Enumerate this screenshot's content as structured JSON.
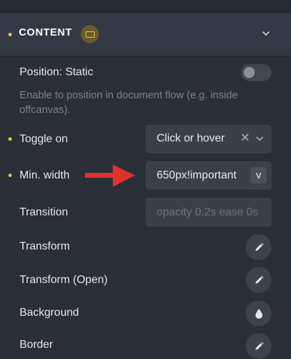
{
  "section": {
    "title": "CONTENT",
    "badge_icon": "monitor-icon",
    "collapse_icon": "chevron-down-icon",
    "accent_color": "#e8c547"
  },
  "position": {
    "label": "Position: Static",
    "enabled": false,
    "description": "Enable to position in document flow (e.g. inside offcanvas)."
  },
  "toggle_on": {
    "label": "Toggle on",
    "value": "Click or hover",
    "clear_icon": "close-icon",
    "dropdown_icon": "chevron-down-icon"
  },
  "min_width": {
    "label": "Min. width",
    "value": "650px!important",
    "unit": "v"
  },
  "transition": {
    "label": "Transition",
    "placeholder": "opacity 0.2s ease 0s"
  },
  "transform": {
    "label": "Transform",
    "icon": "pencil-icon"
  },
  "transform_open": {
    "label": "Transform (Open)",
    "icon": "pencil-icon"
  },
  "background": {
    "label": "Background",
    "icon": "droplet-icon"
  },
  "border": {
    "label": "Border",
    "icon": "pencil-icon"
  },
  "annotation": {
    "icon": "red-arrow-icon",
    "color": "#e0312a"
  }
}
